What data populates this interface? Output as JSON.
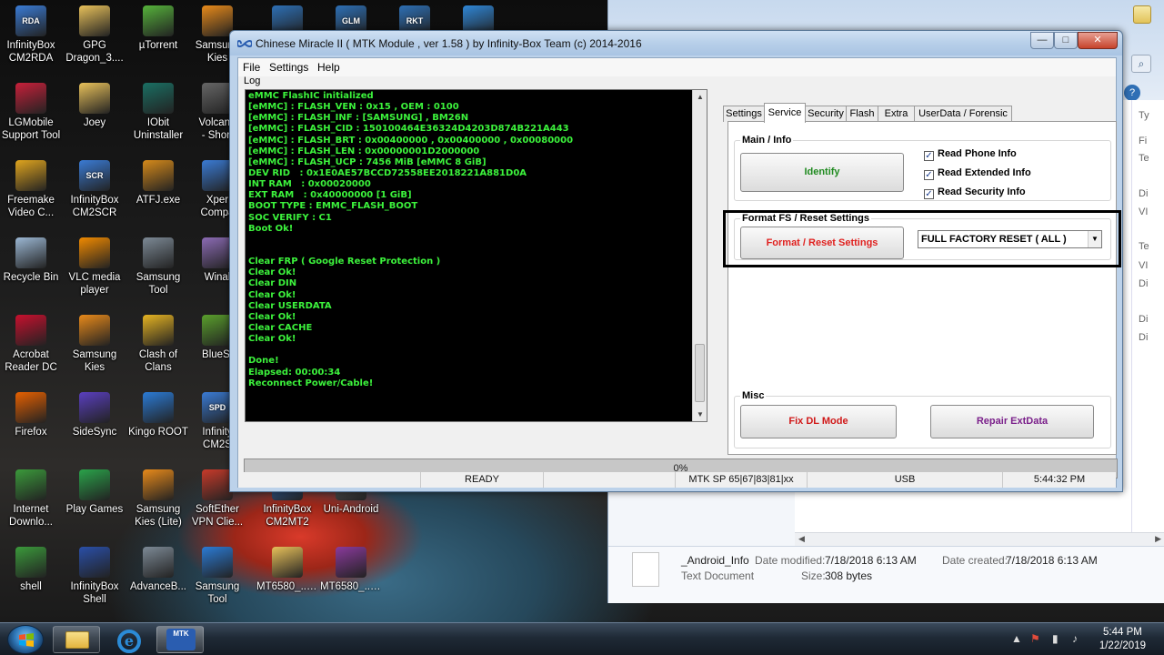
{
  "desktop": {
    "icons": [
      {
        "label": "InfinityBox\nCM2RDA",
        "tag": "RDA",
        "color": "#3a7bd5"
      },
      {
        "label": "GPG\nDragon_3....",
        "tag": "",
        "color": "#e8c15a"
      },
      {
        "label": "µTorrent",
        "tag": "",
        "color": "#56b33b"
      },
      {
        "label": "Samsung\nKies",
        "tag": "",
        "color": "#e88a1a"
      },
      {
        "label": "",
        "tag": "",
        "color": "#2d6fb5"
      },
      {
        "label": "",
        "tag": "GLM",
        "color": "#2d6fb5"
      },
      {
        "label": "",
        "tag": "RKT",
        "color": "#2d6fb5"
      },
      {
        "label": "",
        "tag": "",
        "color": "#2f86d6"
      },
      {
        "label": "LGMobile\nSupport Tool",
        "tag": "",
        "color": "#c8203a"
      },
      {
        "label": "Joey",
        "tag": "",
        "color": "#e8c15a"
      },
      {
        "label": "IObit\nUninstaller",
        "tag": "",
        "color": "#1a6f63"
      },
      {
        "label": "Volcano\n- Short",
        "tag": "",
        "color": "#666"
      },
      {
        "label": "Freemake\nVideo C...",
        "tag": "",
        "color": "#e0a51e"
      },
      {
        "label": "InfinityBox\nCM2SCR",
        "tag": "SCR",
        "color": "#3a7bd5"
      },
      {
        "label": "ATFJ.exe",
        "tag": "",
        "color": "#d68a1a"
      },
      {
        "label": "Xper\nCompa",
        "tag": "",
        "color": "#3a7bd5"
      },
      {
        "label": "Recycle Bin",
        "tag": "",
        "color": "#9cb8d4"
      },
      {
        "label": "VLC media\nplayer",
        "tag": "",
        "color": "#f08a00"
      },
      {
        "label": "Samsung\nTool",
        "tag": "",
        "color": "#7d8a96"
      },
      {
        "label": "Winal",
        "tag": "",
        "color": "#8c6bb5"
      },
      {
        "label": "Acrobat\nReader DC",
        "tag": "",
        "color": "#c8102e"
      },
      {
        "label": "Samsung\nKies",
        "tag": "",
        "color": "#e88a1a"
      },
      {
        "label": "Clash of\nClans",
        "tag": "",
        "color": "#e6b422"
      },
      {
        "label": "BlueSt",
        "tag": "",
        "color": "#5aa02c"
      },
      {
        "label": "Firefox",
        "tag": "",
        "color": "#e66000"
      },
      {
        "label": "SideSync",
        "tag": "",
        "color": "#5a3fc0"
      },
      {
        "label": "Kingo ROOT",
        "tag": "",
        "color": "#2b7bd6"
      },
      {
        "label": "Infinity\nCM2S",
        "tag": "SPD",
        "color": "#3a7bd5"
      },
      {
        "label": "Internet\nDownlo...",
        "tag": "",
        "color": "#3b9a3b"
      },
      {
        "label": "Play Games",
        "tag": "",
        "color": "#2aa34a"
      },
      {
        "label": "Samsung\nKies (Lite)",
        "tag": "",
        "color": "#e88a1a"
      },
      {
        "label": "SoftEther\nVPN Clie...",
        "tag": "",
        "color": "#c83a2a"
      },
      {
        "label": "InfinityBox\nCM2MT2",
        "tag": "",
        "color": "#3a7bd5"
      },
      {
        "label": "Uni-Android",
        "tag": "",
        "color": "#6a6a6a"
      },
      {
        "label": "shell",
        "tag": "",
        "color": "#3b9a3b"
      },
      {
        "label": "InfinityBox\nShell",
        "tag": "",
        "color": "#2a4fa8"
      },
      {
        "label": "AdvanceB...",
        "tag": "",
        "color": "#7d8a96"
      },
      {
        "label": "Samsung\nTool",
        "tag": "",
        "color": "#2b7bd6"
      },
      {
        "label": "MT6580_...B...",
        "tag": "",
        "color": "#e8c15a"
      },
      {
        "label": "MT6580_...B...",
        "tag": "",
        "color": "#8a3a9c"
      }
    ]
  },
  "explorer": {
    "file_name": "_Android_Info",
    "file_type": "Text Document",
    "date_modified_label": "Date modified:",
    "date_modified": "7/18/2018 6:13 AM",
    "date_created_label": "Date created:",
    "date_created": "7/18/2018 6:13 AM",
    "size_label": "Size:",
    "size": "308 bytes",
    "side_letters": [
      "Ty",
      "Fi",
      "Te",
      "Di",
      "VI",
      "Te",
      "VI",
      "Di",
      "Di",
      "Di"
    ]
  },
  "window": {
    "title": "Chinese Miracle II ( MTK Module , ver 1.58 ) by Infinity-Box Team (c) 2014-2016",
    "caption_min": "—",
    "caption_max": "□",
    "caption_close": "✕",
    "menu": [
      "File",
      "Settings",
      "Help"
    ],
    "log_label": "Log",
    "log_lines": [
      "eMMC FlashIC initialized",
      "[eMMC] : FLASH_VEN : 0x15 , OEM : 0100",
      "[eMMC] : FLASH_INF : [SAMSUNG] , BM26N",
      "[eMMC] : FLASH_CID : 150100464E36324D4203D874B221A443",
      "[eMMC] : FLASH_BRT : 0x00400000 , 0x00400000 , 0x00080000",
      "[eMMC] : FLASH_LEN : 0x00000001D2000000",
      "[eMMC] : FLASH_UCP : 7456 MiB [eMMC 8 GiB]",
      "DEV RID   : 0x1E0AE57BCCD72558EE2018221A881D0A",
      "INT RAM   : 0x00020000",
      "EXT RAM   : 0x40000000 [1 GiB]",
      "BOOT TYPE : EMMC_FLASH_BOOT",
      "SOC VERIFY : C1",
      "Boot Ok!",
      "",
      "",
      "Clear FRP ( Google Reset Protection )",
      "Clear Ok!",
      "Clear DIN",
      "Clear Ok!",
      "Clear USERDATA",
      "Clear Ok!",
      "Clear CACHE",
      "Clear Ok!",
      "",
      "Done!",
      "Elapsed: 00:00:34",
      "Reconnect Power/Cable!"
    ],
    "tabs": [
      "Settings",
      "Service",
      "Security",
      "Flash",
      "Extra",
      "UserData / Forensic"
    ],
    "active_tab": "Service",
    "main_info": {
      "title": "Main / Info",
      "identify_label": "Identify",
      "checkboxes": [
        {
          "label": "Read Phone Info",
          "checked": true
        },
        {
          "label": "Read Extended Info",
          "checked": true
        },
        {
          "label": "Read Security Info",
          "checked": true
        }
      ]
    },
    "format": {
      "title": "Format FS / Reset Settings",
      "button_label": "Format / Reset Settings",
      "select_value": "FULL FACTORY RESET ( ALL )"
    },
    "misc": {
      "title": "Misc",
      "fix_dl_label": "Fix DL Mode",
      "repair_label": "Repair ExtData"
    },
    "progress_percent": 0,
    "progress_label": "0%",
    "status": {
      "state": "READY",
      "platform": "MTK SP 65|67|83|81|xx",
      "connection": "USB",
      "time": "5:44:32 PM"
    }
  },
  "colors": {
    "log_text": "#3cf23c",
    "identify": "#1f8a1f",
    "format": "#e0201e",
    "fix_dl": "#d01818",
    "repair": "#7a1f8a"
  },
  "taskbar": {
    "clock_time": "5:44 PM",
    "clock_date": "1/22/2019",
    "pinned": [
      "explorer",
      "internet-explorer",
      "mtk-cm2"
    ]
  }
}
